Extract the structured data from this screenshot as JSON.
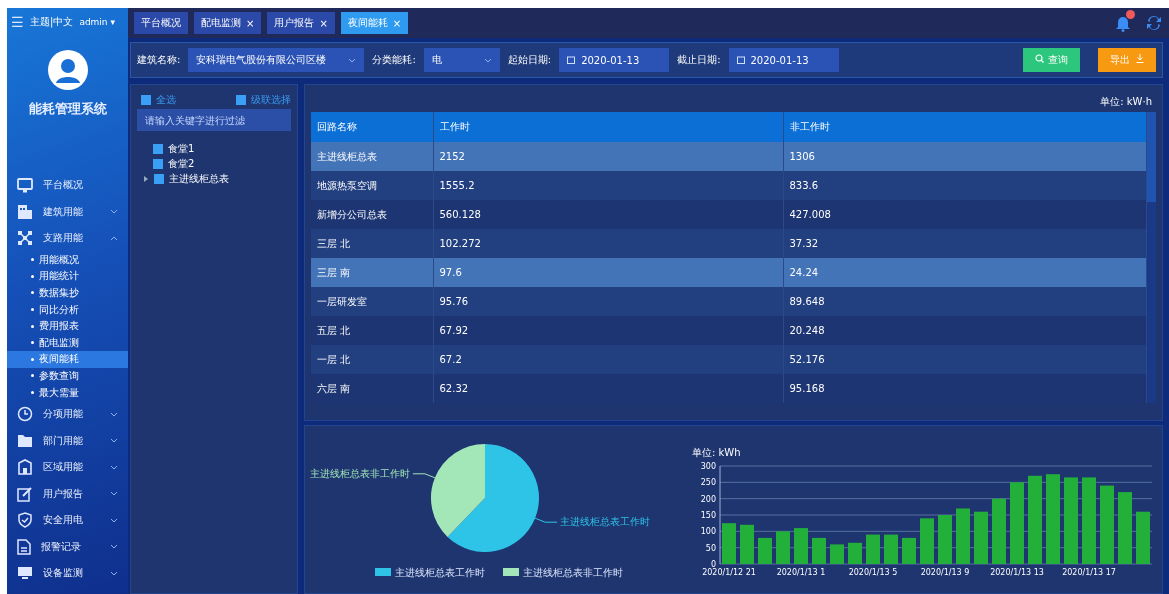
{
  "topbar": {
    "menu": "☰",
    "theme": "主题|中文",
    "user": "admin",
    "user_caret": "▾"
  },
  "tabs": [
    {
      "label": "平台概况",
      "selected": false
    },
    {
      "label": "配电监测",
      "close": "×",
      "selected": false
    },
    {
      "label": "用户报告",
      "close": "×",
      "selected": false
    },
    {
      "label": "夜间能耗",
      "close": "×",
      "selected": true
    }
  ],
  "sidebar": {
    "title": "能耗管理系统",
    "items": [
      {
        "label": "平台概况",
        "kind": "link",
        "selected": false
      },
      {
        "label": "建筑用能",
        "kind": "group",
        "expanded": false
      },
      {
        "label": "支路用能",
        "kind": "group",
        "expanded": true,
        "children": [
          {
            "label": "用能概况",
            "selected": false
          },
          {
            "label": "用能统计",
            "selected": false
          },
          {
            "label": "数据集抄",
            "selected": false
          },
          {
            "label": "同比分析",
            "selected": false
          },
          {
            "label": "费用报表",
            "selected": false
          },
          {
            "label": "配电监测",
            "selected": false
          },
          {
            "label": "夜间能耗",
            "selected": true
          },
          {
            "label": "参数查询",
            "selected": false
          },
          {
            "label": "最大需量",
            "selected": false
          }
        ]
      },
      {
        "label": "分项用能",
        "kind": "group",
        "expanded": false
      },
      {
        "label": "部门用能",
        "kind": "group",
        "expanded": false
      },
      {
        "label": "区域用能",
        "kind": "group",
        "expanded": false
      },
      {
        "label": "用户报告",
        "kind": "group",
        "expanded": false
      },
      {
        "label": "安全用电",
        "kind": "group",
        "expanded": false
      },
      {
        "label": "报警记录",
        "kind": "group",
        "expanded": false
      },
      {
        "label": "设备监测",
        "kind": "group",
        "expanded": false
      }
    ]
  },
  "filters": {
    "building_label": "建筑名称:",
    "building": "安科瑞电气股份有限公司区楼",
    "category_label": "分类能耗:",
    "category": "电",
    "start_label": "起始日期:",
    "start": "2020-01-13",
    "end_label": "截止日期:",
    "end": "2020-01-13",
    "query": "查询",
    "export": "导出"
  },
  "tree": {
    "select_all": {
      "label": "全选",
      "checked": true
    },
    "cascade": {
      "label": "级联选择",
      "checked": true
    },
    "search": {
      "placeholder": "请输入关键字进行过滤"
    },
    "nodes": [
      {
        "label": "食堂1",
        "kind": "leaf",
        "checked": true
      },
      {
        "label": "食堂2",
        "kind": "leaf",
        "checked": true
      },
      {
        "label": "主进线柜总表",
        "kind": "branch",
        "expanded": false,
        "checked": true
      }
    ]
  },
  "table": {
    "unit": "单位:  kW·h",
    "columns": [
      "回路名称",
      "工作时",
      "非工作时"
    ],
    "rows": [
      {
        "cells": [
          "主进线柜总表",
          "2152",
          "1306"
        ],
        "selected": true
      },
      {
        "cells": [
          "地源热泵空调",
          "1555.2",
          "833.6"
        ],
        "selected": false
      },
      {
        "cells": [
          "新增分公司总表",
          "560.128",
          "427.008"
        ],
        "selected": false
      },
      {
        "cells": [
          "三层 北",
          "102.272",
          "37.32"
        ],
        "selected": false
      },
      {
        "cells": [
          "三层 南",
          "97.6",
          "24.24"
        ],
        "selected": true
      },
      {
        "cells": [
          "一层研发室",
          "95.76",
          "89.648"
        ],
        "selected": false
      },
      {
        "cells": [
          "五层 北",
          "67.92",
          "20.248"
        ],
        "selected": false
      },
      {
        "cells": [
          "一层 北",
          "67.2",
          "52.176"
        ],
        "selected": false
      },
      {
        "cells": [
          "六层 南",
          "62.32",
          "95.168"
        ],
        "selected": false
      }
    ]
  },
  "pie": {
    "chart_data": {
      "type": "pie",
      "categories": [
        "主进线柜总表工作时",
        "主进线柜总表非工作时"
      ],
      "values": [
        62.2,
        37.8
      ],
      "colors": [
        "#2ec4e8",
        "#a3e6b8"
      ],
      "legend": true
    }
  },
  "bars": {
    "chart_data": {
      "type": "bar",
      "ylabel": "单位:  kWh",
      "categories": [
        "2020/1/12 21",
        null,
        null,
        null,
        "2020/1/13 1",
        null,
        null,
        null,
        "2020/1/13 5",
        null,
        null,
        null,
        "2020/1/13 9",
        null,
        null,
        null,
        "2020/1/13 13",
        null,
        null,
        null,
        "2020/1/13 17",
        null,
        null,
        null
      ],
      "series": [
        {
          "color": "#22b03a",
          "values": [
            125,
            120,
            80,
            100,
            110,
            80,
            60,
            65,
            90,
            90,
            80,
            140,
            150,
            170,
            160,
            200,
            250,
            270,
            275,
            265,
            265,
            240,
            220,
            160
          ]
        }
      ],
      "ylim": [
        0,
        300
      ],
      "yticks": [
        0,
        50,
        100,
        150,
        200,
        250,
        300
      ],
      "grid": true
    }
  }
}
